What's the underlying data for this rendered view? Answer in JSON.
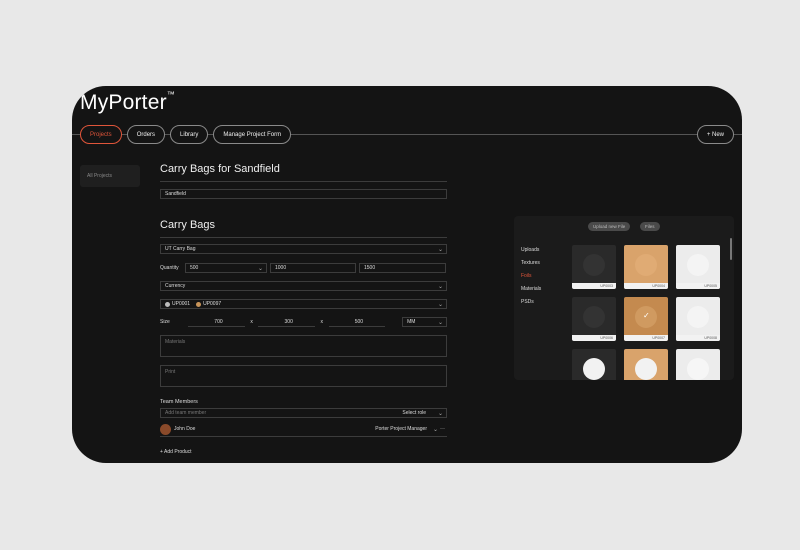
{
  "app": {
    "brand": "MyPorter",
    "tm": "™"
  },
  "nav": {
    "items": [
      "Projects",
      "Orders",
      "Library",
      "Manage Project Form"
    ],
    "new_label": "+ New"
  },
  "sidebar": {
    "all_projects": "All Projects"
  },
  "form": {
    "project_title": "Carry Bags for Sandfield",
    "project_name_value": "Sandfield",
    "section_title": "Carry Bags",
    "product_type": "UT Carry Bag",
    "quantity_label": "Quantity",
    "quantities": [
      "500",
      "1000",
      "1500"
    ],
    "currency_placeholder": "Currency",
    "uploads": [
      "UP0001",
      "UP0097"
    ],
    "size_label": "Size",
    "size": {
      "w": "700",
      "h": "300",
      "d": "500",
      "x": "x",
      "unit": "MM"
    },
    "materials_placeholder": "Materials",
    "print_placeholder": "Print",
    "team_title": "Team Members",
    "add_member_placeholder": "Add team member",
    "select_role": "Select role",
    "member": {
      "name": "John Doe",
      "role": "Porter Project Manager"
    },
    "add_product": "+ Add Product"
  },
  "library_panel": {
    "upload_button": "Upload new File",
    "files_button": "Files",
    "categories": [
      "Uploads",
      "Textures",
      "Foils",
      "Materials",
      "PSDs"
    ],
    "selected_category": "Foils",
    "tiles": [
      "UP0003",
      "UP0004",
      "UP0005",
      "UP0006",
      "UP0007",
      "UP0008",
      "",
      "",
      ""
    ]
  },
  "colors": {
    "accent": "#e0553a",
    "background": "#141414",
    "frame": "#e8e8e8"
  }
}
